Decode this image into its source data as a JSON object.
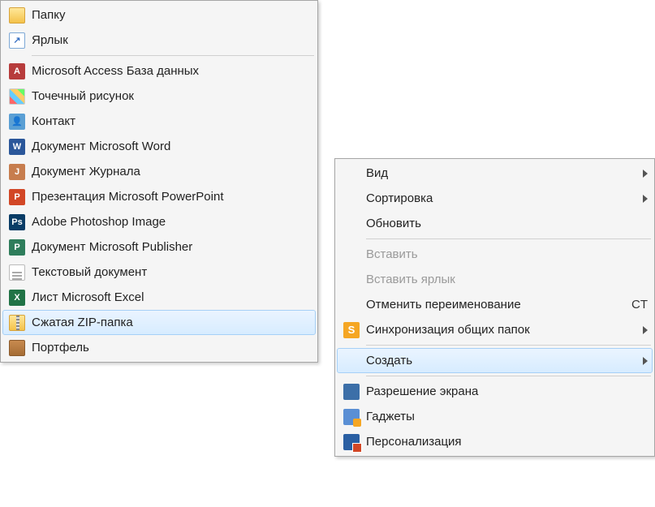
{
  "context_menu": {
    "items": [
      {
        "label": "Вид",
        "has_submenu": true
      },
      {
        "label": "Сортировка",
        "has_submenu": true
      },
      {
        "label": "Обновить"
      },
      {
        "separator": true
      },
      {
        "label": "Вставить",
        "disabled": true
      },
      {
        "label": "Вставить ярлык",
        "disabled": true
      },
      {
        "label": "Отменить переименование",
        "shortcut": "CT"
      },
      {
        "label": "Синхронизация общих папок",
        "icon": "sync",
        "has_submenu": true
      },
      {
        "separator": true
      },
      {
        "label": "Создать",
        "has_submenu": true,
        "hover": true
      },
      {
        "separator": true
      },
      {
        "label": "Разрешение экрана",
        "icon": "display"
      },
      {
        "label": "Гаджеты",
        "icon": "gadget"
      },
      {
        "label": "Персонализация",
        "icon": "personalize"
      }
    ]
  },
  "new_submenu": {
    "items": [
      {
        "label": "Папку",
        "icon": "folder"
      },
      {
        "label": "Ярлык",
        "icon": "shortcut"
      },
      {
        "separator": true
      },
      {
        "label": "Microsoft Access База данных",
        "icon": "access"
      },
      {
        "label": "Точечный рисунок",
        "icon": "bmp"
      },
      {
        "label": "Контакт",
        "icon": "contact"
      },
      {
        "label": "Документ Microsoft Word",
        "icon": "word"
      },
      {
        "label": "Документ Журнала",
        "icon": "journal"
      },
      {
        "label": "Презентация Microsoft PowerPoint",
        "icon": "ppt"
      },
      {
        "label": "Adobe Photoshop Image",
        "icon": "psd"
      },
      {
        "label": "Документ Microsoft Publisher",
        "icon": "pub"
      },
      {
        "label": "Текстовый документ",
        "icon": "txt"
      },
      {
        "label": "Лист Microsoft Excel",
        "icon": "excel"
      },
      {
        "label": "Сжатая ZIP-папка",
        "icon": "zip",
        "hover": true
      },
      {
        "label": "Портфель",
        "icon": "briefcase"
      }
    ]
  }
}
